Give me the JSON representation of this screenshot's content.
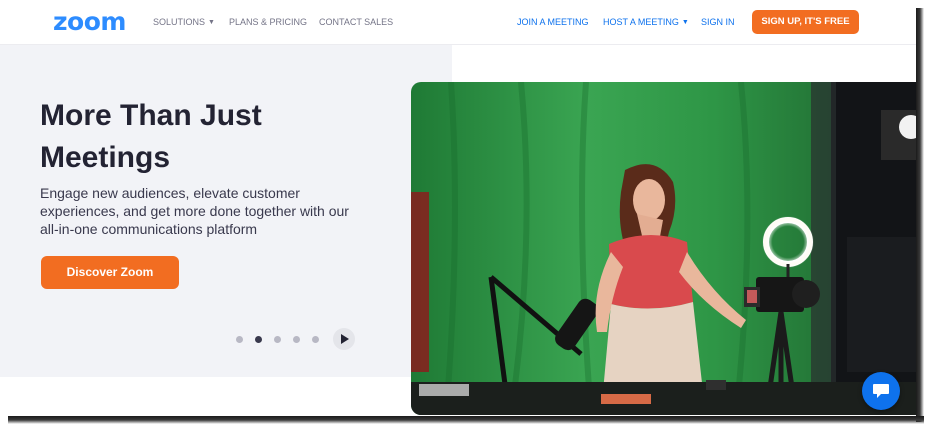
{
  "brand": {
    "logo": "zoom",
    "color": "#2d8cff"
  },
  "nav": {
    "left": [
      {
        "label": "SOLUTIONS",
        "dropdown": true
      },
      {
        "label": "PLANS & PRICING",
        "dropdown": false
      },
      {
        "label": "CONTACT SALES",
        "dropdown": false
      }
    ],
    "right": [
      {
        "label": "JOIN A MEETING",
        "dropdown": false
      },
      {
        "label": "HOST A MEETING",
        "dropdown": true
      },
      {
        "label": "SIGN IN",
        "dropdown": false
      }
    ],
    "signup_label": "SIGN UP, IT'S FREE",
    "accent": "#f26d21"
  },
  "hero": {
    "title": "More Than Just Meetings",
    "subtitle": "Engage new audiences, elevate customer experiences, and get more done together with our all-in-one communications platform",
    "cta_label": "Discover Zoom",
    "carousel": {
      "slide_count": 5,
      "active_slide": 2,
      "control_icon": "play-icon"
    },
    "image": "woman-recording-video-with-ring-light-and-microphone-in-front-of-green-screen"
  },
  "chat_widget": {
    "icon": "chat-icon",
    "color": "#0e72ed"
  }
}
